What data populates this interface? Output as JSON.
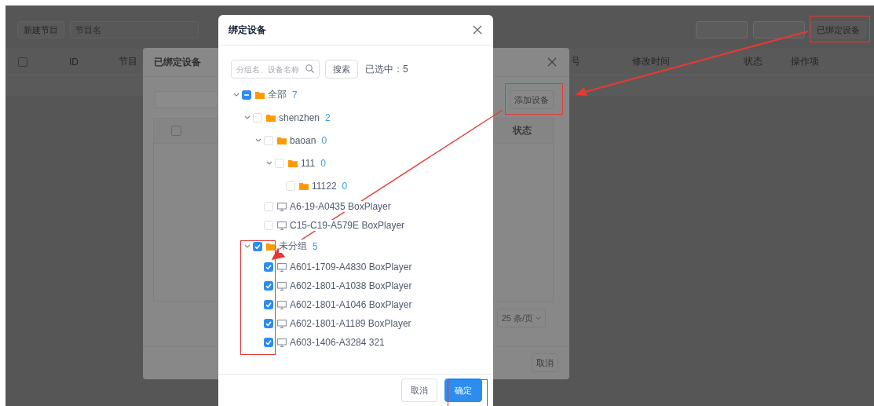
{
  "page": {
    "toolbar": {
      "new_button": "新建节目",
      "search": {
        "placeholder": "节目名"
      },
      "bound_button": "已绑定设备"
    },
    "table": {
      "header_checkbox": {
        "checked": false
      },
      "columns": [
        "ID",
        "节目",
        "号",
        "修改时间",
        "状态",
        "操作项"
      ]
    }
  },
  "bound_dialog": {
    "title": "已绑定设备",
    "add_button": "添加设备",
    "table": {
      "header_checkbox": {
        "checked": false
      },
      "columns": [
        "状态"
      ]
    },
    "page_size": "25 条/页",
    "cancel_button": "取消"
  },
  "bind_dialog": {
    "title": "绑定设备",
    "search": {
      "placeholder": "分组名、设备名称"
    },
    "search_button": "搜索",
    "selected_count": "已选中：5",
    "tree": [
      {
        "kind": "folder",
        "label": "全部",
        "count": "7",
        "expanded": true,
        "checked": false,
        "indeterminate": true,
        "children": [
          {
            "kind": "folder",
            "label": "shenzhen",
            "count": "2",
            "expanded": true,
            "checked": false,
            "indeterminate": false,
            "children": [
              {
                "kind": "folder",
                "label": "baoan",
                "count": "0",
                "expanded": true,
                "checked": false,
                "indeterminate": false,
                "children": [
                  {
                    "kind": "folder",
                    "label": "111",
                    "count": "0",
                    "expanded": true,
                    "checked": false,
                    "indeterminate": false,
                    "children": [
                      {
                        "kind": "folder",
                        "label": "11122",
                        "count": "0",
                        "checked": false,
                        "indeterminate": false
                      }
                    ]
                  }
                ]
              },
              {
                "kind": "device",
                "label": "A6-19-A0435 BoxPlayer",
                "checked": false,
                "indeterminate": false
              },
              {
                "kind": "device",
                "label": "C15-C19-A579E BoxPlayer",
                "checked": false,
                "indeterminate": false
              }
            ]
          },
          {
            "kind": "folder",
            "label": "未分组",
            "count": "5",
            "expanded": true,
            "checked": true,
            "indeterminate": false,
            "children": [
              {
                "kind": "device",
                "label": "A601-1709-A4830 BoxPlayer",
                "checked": true,
                "indeterminate": false
              },
              {
                "kind": "device",
                "label": "A602-1801-A1038 BoxPlayer",
                "checked": true,
                "indeterminate": false
              },
              {
                "kind": "device",
                "label": "A602-1801-A1046 BoxPlayer",
                "checked": true,
                "indeterminate": false
              },
              {
                "kind": "device",
                "label": "A602-1801-A1189 BoxPlayer",
                "checked": true,
                "indeterminate": false
              },
              {
                "kind": "device",
                "label": "A603-1406-A3284 321",
                "checked": true,
                "indeterminate": false
              }
            ]
          }
        ]
      }
    ],
    "cancel_button": "取消",
    "confirm_button": "确定"
  }
}
